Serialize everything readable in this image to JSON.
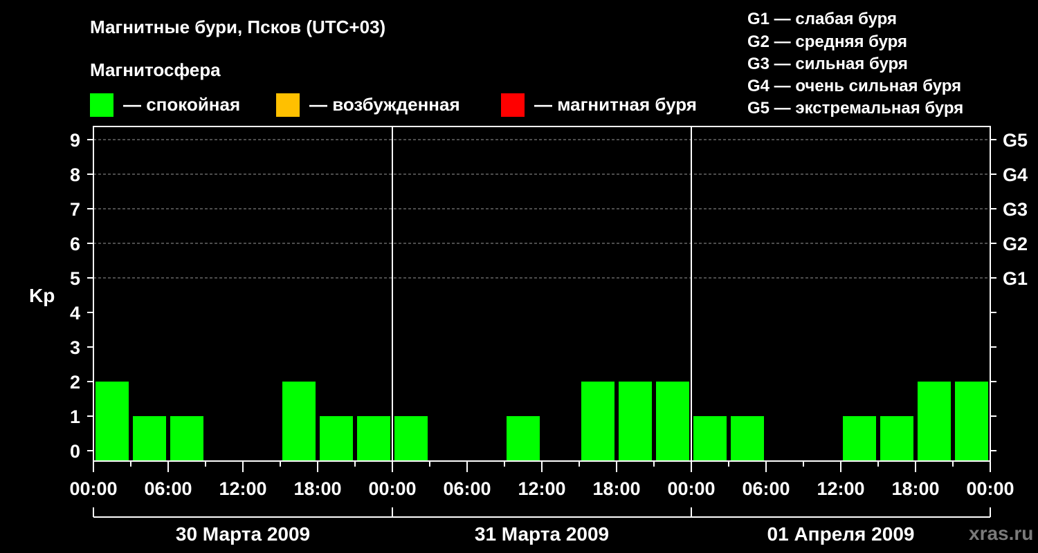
{
  "title": "Магнитные бури, Псков (UTC+03)",
  "subtitle": "Магнитосфера",
  "legend": [
    {
      "label": "— спокойная",
      "color": "#00ff00"
    },
    {
      "label": "— возбужденная",
      "color": "#ffc000"
    },
    {
      "label": "— магнитная буря",
      "color": "#ff0000"
    }
  ],
  "g_legend": [
    "G1 — слабая буря",
    "G2 — средняя буря",
    "G3 — сильная буря",
    "G4 — очень сильная буря",
    "G5 — экстремальная буря"
  ],
  "watermark": "xras.ru",
  "chart_data": {
    "type": "bar",
    "ylabel": "Kp",
    "ylim": [
      0,
      9
    ],
    "y_ticks": [
      0,
      1,
      2,
      3,
      4,
      5,
      6,
      7,
      8,
      9
    ],
    "y2_ticks": [
      {
        "value": 5,
        "label": "G1"
      },
      {
        "value": 6,
        "label": "G2"
      },
      {
        "value": 7,
        "label": "G3"
      },
      {
        "value": 8,
        "label": "G4"
      },
      {
        "value": 9,
        "label": "G5"
      }
    ],
    "grid": true,
    "x_tick_labels": [
      "00:00",
      "06:00",
      "12:00",
      "18:00",
      "00:00",
      "06:00",
      "12:00",
      "18:00",
      "00:00",
      "06:00",
      "12:00",
      "18:00",
      "00:00"
    ],
    "days": [
      "30 Марта 2009",
      "31 Марта 2009",
      "01 Апреля 2009"
    ],
    "interval_hours": 3,
    "values": [
      2,
      1,
      1,
      0,
      0,
      2,
      1,
      1,
      1,
      0,
      0,
      1,
      0,
      2,
      2,
      2,
      1,
      1,
      0,
      0,
      1,
      1,
      2,
      2
    ],
    "colors": {
      "quiet": "#00ff00",
      "active": "#ffc000",
      "storm": "#ff0000"
    }
  }
}
